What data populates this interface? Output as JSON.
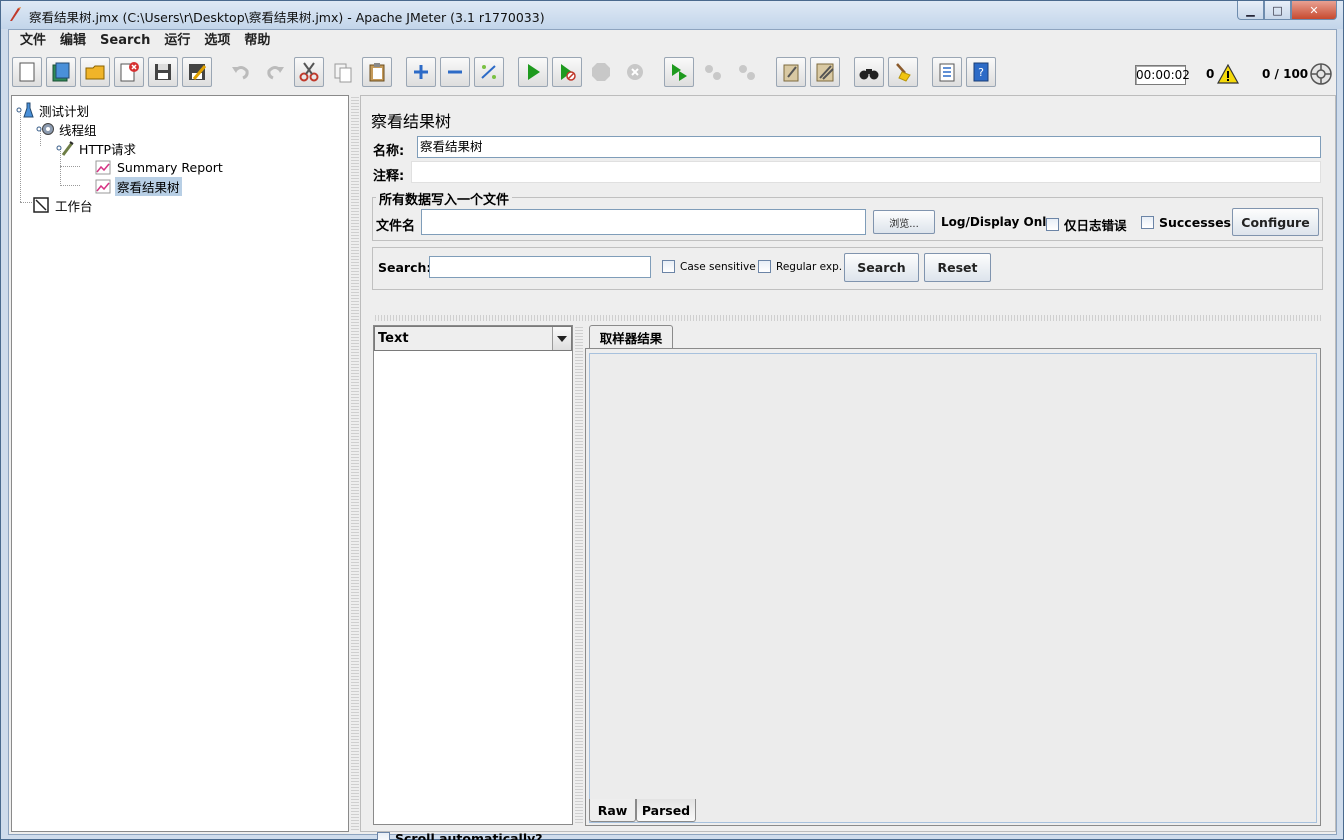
{
  "window": {
    "title": "察看结果树.jmx (C:\\Users\\r\\Desktop\\察看结果树.jmx) - Apache JMeter (3.1 r1770033)",
    "min_label": "▁",
    "max_label": "□",
    "close_label": "✕"
  },
  "menu": [
    "文件",
    "编辑",
    "Search",
    "运行",
    "选项",
    "帮助"
  ],
  "toolbar": {
    "timer": "00:00:02",
    "error_count": "0",
    "threads": "0 / 100"
  },
  "tree": {
    "items": [
      "测试计划",
      "线程组",
      "HTTP请求",
      "Summary Report",
      "察看结果树",
      "工作台"
    ]
  },
  "panel": {
    "title": "察看结果树",
    "name_label": "名称:",
    "name_value": "察看结果树",
    "comment_label": "注释:",
    "comment_value": "",
    "file_group_title": "所有数据写入一个文件",
    "filename_label": "文件名",
    "filename_value": "",
    "browse_label": "浏览...",
    "log_display_label": "Log/Display Only:",
    "errors_only_label": "仅日志错误",
    "successes_label": "Successes",
    "configure_label": "Configure",
    "search_label": "Search:",
    "search_value": "",
    "case_sensitive_label": "Case sensitive",
    "regex_label": "Regular exp.",
    "search_button": "Search",
    "reset_button": "Reset",
    "renderer_selected": "Text",
    "scroll_auto_label": "Scroll automatically?",
    "sampler_tab": "取样器结果",
    "raw_tab": "Raw",
    "parsed_tab": "Parsed"
  }
}
